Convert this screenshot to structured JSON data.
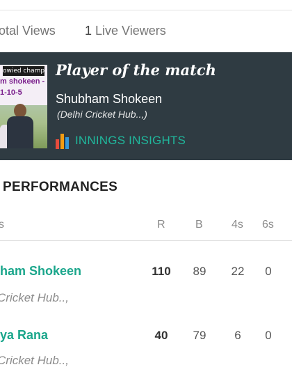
{
  "views": {
    "total_label": "otal Views",
    "live_count": "1",
    "live_label": "Live Viewers"
  },
  "potm": {
    "photo_banner_top": "owied champ",
    "photo_banner_mid": "m shokeen -",
    "photo_banner_bot": "1-10-5",
    "title": "Player of the match",
    "name": "Shubham Shokeen",
    "team": "(Delhi Cricket Hub..,)",
    "insights_label": "INNINGS INSIGHTS",
    "insights_colors": [
      "#e74c3c",
      "#f39c12",
      "#3498db"
    ]
  },
  "performances": {
    "title": "PERFORMANCES",
    "columns": [
      "s",
      "R",
      "B",
      "4s",
      "6s"
    ],
    "rows": [
      {
        "name": "ham Shokeen",
        "team": "Cricket Hub..,",
        "R": "110",
        "B": "89",
        "4s": "22",
        "6s": "0"
      },
      {
        "name": "ya Rana",
        "team": "Cricket Hub..,",
        "R": "40",
        "B": "79",
        "4s": "6",
        "6s": "0"
      }
    ]
  }
}
